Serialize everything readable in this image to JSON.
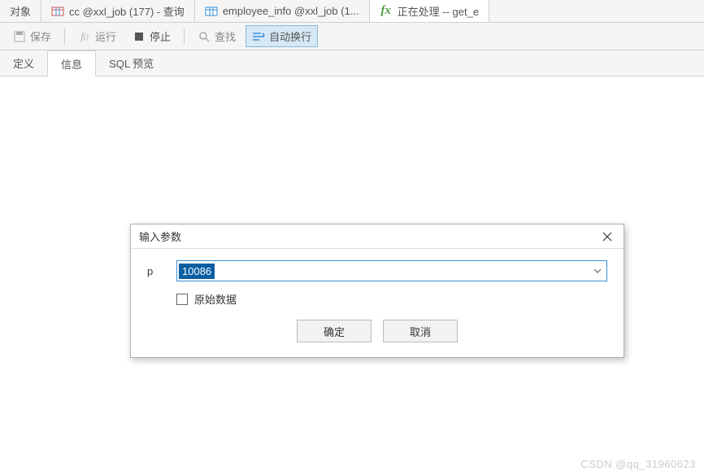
{
  "topTabs": {
    "objects": "对象",
    "tab1": "cc @xxl_job (177) - 查询",
    "tab2": "employee_info @xxl_job (1...",
    "tab3": "正在处理 -- get_e"
  },
  "toolbar": {
    "save": "保存",
    "run": "运行",
    "stop": "停止",
    "find": "查找",
    "wrap": "自动换行"
  },
  "subTabs": {
    "define": "定义",
    "info": "信息",
    "sqlPreview": "SQL 预览"
  },
  "dialog": {
    "title": "输入参数",
    "paramLabel": "p",
    "paramValue": "10086",
    "rawData": "原始数据",
    "ok": "确定",
    "cancel": "取消"
  },
  "watermark": "CSDN @qq_31960623"
}
